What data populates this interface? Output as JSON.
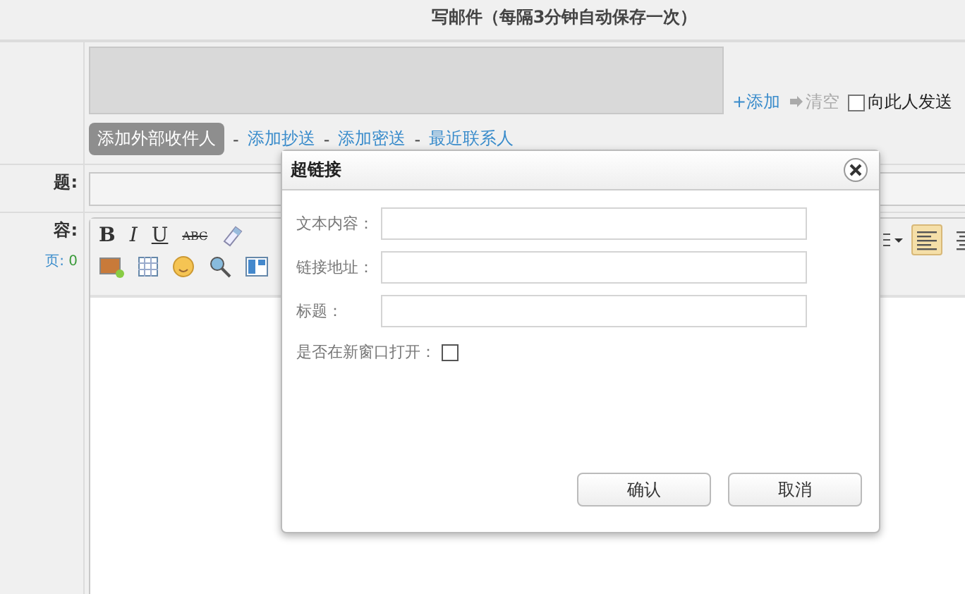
{
  "page_title": "写邮件（每隔3分钟自动保存一次）",
  "recipients": {
    "add": "+添加",
    "clear": "清空",
    "send_to_this": {
      "label": "向此人发送",
      "checked": false
    }
  },
  "recipient_actions": {
    "button": "添加外部收件人",
    "links": [
      "添加抄送",
      "添加密送",
      "最近联系人"
    ],
    "separator": "-"
  },
  "subject": {
    "label": "题:"
  },
  "content": {
    "label": "容:",
    "count_label": "页:",
    "count": "0"
  },
  "toolbar": {
    "format_buttons": [
      {
        "kind": "bold",
        "text": "B"
      },
      {
        "kind": "italic",
        "text": "I"
      },
      {
        "kind": "underline",
        "text": "U"
      },
      {
        "kind": "strike",
        "text": "ABC"
      }
    ],
    "align_buttons": [
      {
        "kind": "left",
        "selected": true
      },
      {
        "kind": "center",
        "selected": false
      }
    ]
  },
  "dialog": {
    "title": "超链接",
    "fields": [
      {
        "label": "文本内容："
      },
      {
        "label": "链接地址："
      },
      {
        "label": "标题："
      }
    ],
    "new_window": {
      "label": "是否在新窗口打开：",
      "checked": false
    },
    "buttons": [
      "确认",
      "取消"
    ]
  }
}
